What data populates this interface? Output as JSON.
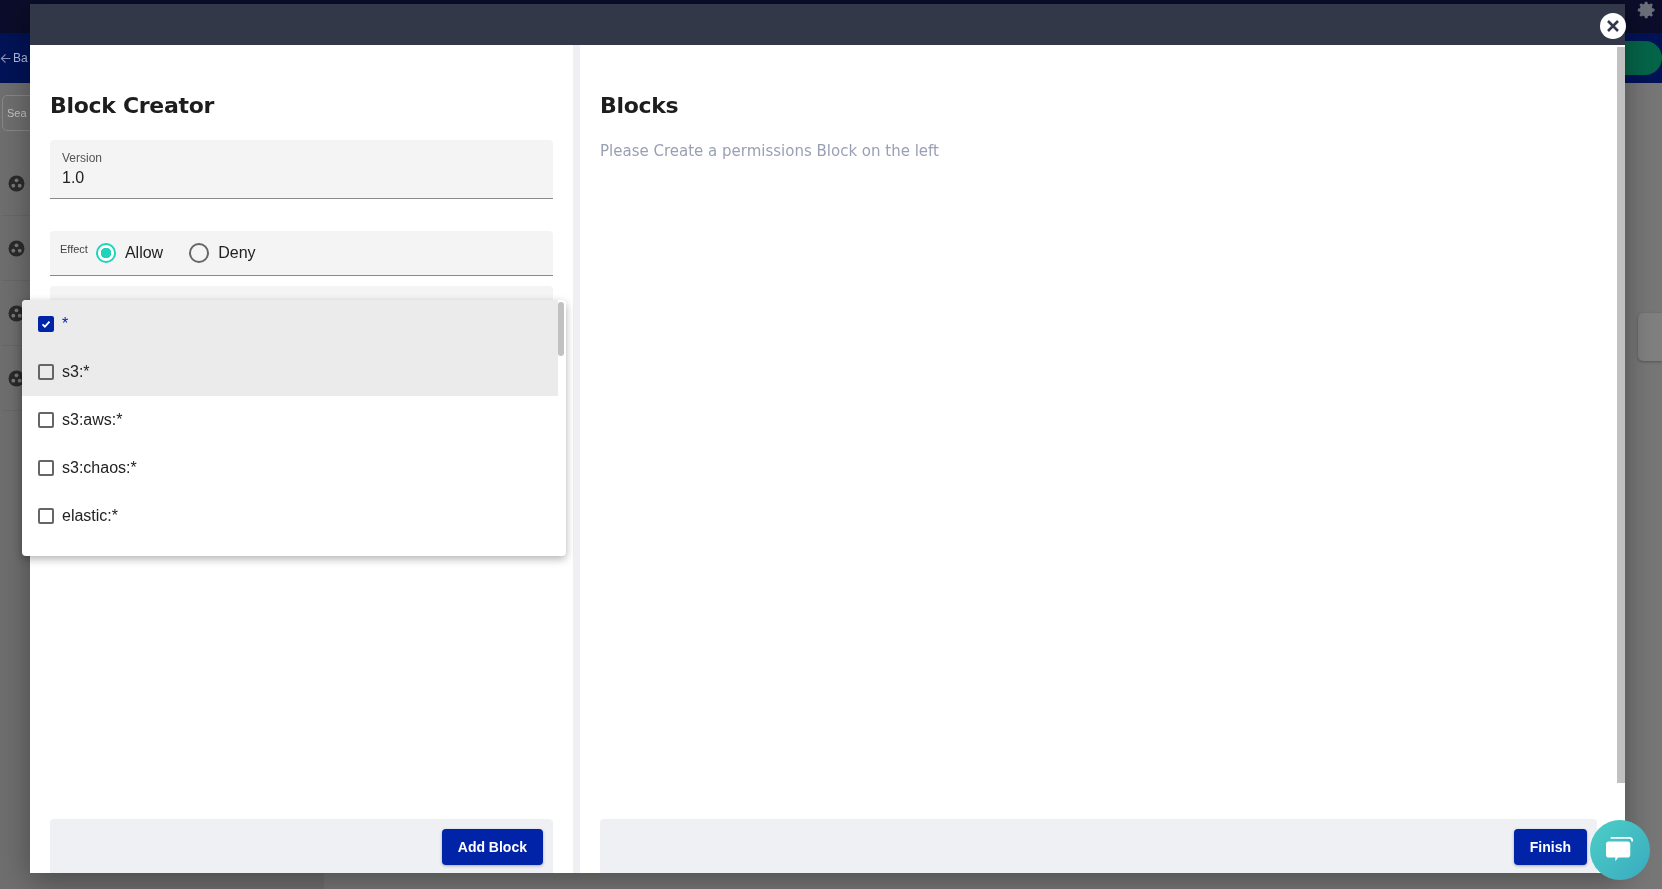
{
  "background": {
    "back_link": "Ba",
    "search": {
      "placeholder": "Sea"
    }
  },
  "dialog": {
    "left": {
      "title": "Block Creator",
      "version": {
        "label": "Version",
        "value": "1.0"
      },
      "effect": {
        "label": "Effect",
        "options": [
          {
            "label": "Allow",
            "selected": true
          },
          {
            "label": "Deny",
            "selected": false
          }
        ]
      },
      "actions_menu": [
        {
          "label": "*",
          "checked": true,
          "highlighted": true
        },
        {
          "label": "s3:*",
          "checked": false,
          "highlighted": true
        },
        {
          "label": "s3:aws:*",
          "checked": false,
          "highlighted": false
        },
        {
          "label": "s3:chaos:*",
          "checked": false,
          "highlighted": false
        },
        {
          "label": "elastic:*",
          "checked": false,
          "highlighted": false
        }
      ],
      "button": "Add Block"
    },
    "right": {
      "title": "Blocks",
      "empty_message": "Please Create a permissions Block on the left",
      "button": "Finish"
    }
  }
}
